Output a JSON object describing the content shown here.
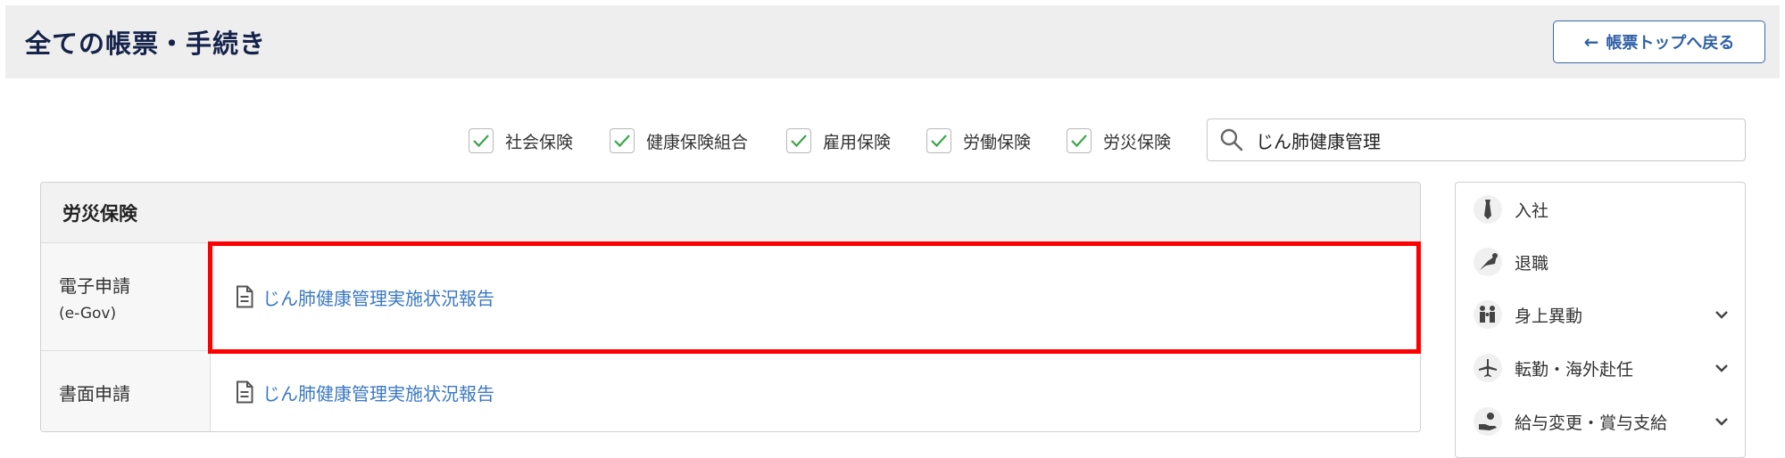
{
  "header": {
    "title": "全ての帳票・手続き",
    "back_button": "帳票トップへ戻る"
  },
  "filters": [
    {
      "label": "社会保険",
      "checked": true
    },
    {
      "label": "健康保険組合",
      "checked": true
    },
    {
      "label": "雇用保険",
      "checked": true
    },
    {
      "label": "労働保険",
      "checked": true
    },
    {
      "label": "労災保険",
      "checked": true
    }
  ],
  "search": {
    "value": "じん肺健康管理"
  },
  "results": {
    "section_title": "労災保険",
    "rows": [
      {
        "label": "電子申請",
        "sublabel": "(e-Gov)",
        "link": "じん肺健康管理実施状況報告"
      },
      {
        "label": "書面申請",
        "sublabel": "",
        "link": "じん肺健康管理実施状況報告"
      }
    ]
  },
  "categories": [
    {
      "label": "入社",
      "icon": "tie-icon",
      "expandable": false
    },
    {
      "label": "退職",
      "icon": "bouquet-icon",
      "expandable": false
    },
    {
      "label": "身上異動",
      "icon": "family-icon",
      "expandable": true
    },
    {
      "label": "転勤・海外赴任",
      "icon": "airplane-icon",
      "expandable": true
    },
    {
      "label": "給与変更・賞与支給",
      "icon": "money-hand-icon",
      "expandable": true
    }
  ],
  "colors": {
    "title": "#15234a",
    "link": "#3a78c3",
    "check": "#3aa64a",
    "highlight": "#ff0000"
  }
}
